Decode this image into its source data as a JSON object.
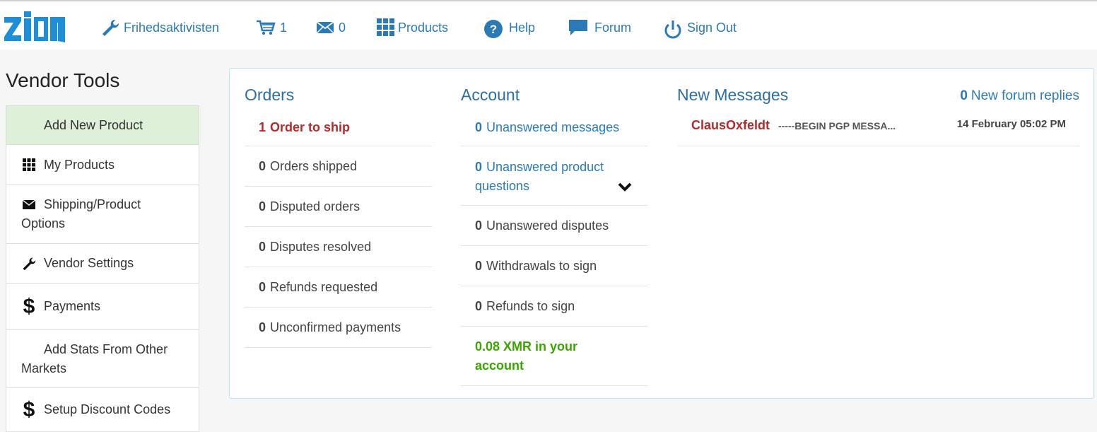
{
  "nav": {
    "logo_text": "zion",
    "username": "Frihedsaktivisten",
    "cart_count": "1",
    "messages_count": "0",
    "products": "Products",
    "help": "Help",
    "forum": "Forum",
    "sign_out": "Sign Out"
  },
  "sidebar": {
    "title": "Vendor Tools",
    "items": [
      {
        "label": "Add New Product"
      },
      {
        "label": "My Products"
      },
      {
        "label_line1": "Shipping/Product",
        "label_line2": "Options"
      },
      {
        "label": "Vendor Settings"
      },
      {
        "label": "Payments"
      },
      {
        "label_line1": "Add Stats From Other",
        "label_line2": "Markets"
      },
      {
        "label": "Setup Discount Codes"
      }
    ]
  },
  "orders": {
    "title": "Orders",
    "rows": [
      {
        "count": "1",
        "label": "Order to ship"
      },
      {
        "count": "0",
        "label": "Orders shipped"
      },
      {
        "count": "0",
        "label": "Disputed orders"
      },
      {
        "count": "0",
        "label": "Disputes resolved"
      },
      {
        "count": "0",
        "label": "Refunds requested"
      },
      {
        "count": "0",
        "label": "Unconfirmed payments"
      }
    ]
  },
  "account": {
    "title": "Account",
    "rows": [
      {
        "count": "0",
        "label": "Unanswered messages"
      },
      {
        "count": "0",
        "label_line1": "Unanswered product",
        "label_line2": "questions"
      },
      {
        "count": "0",
        "label": "Unanswered disputes"
      },
      {
        "count": "0",
        "label": "Withdrawals to sign"
      },
      {
        "count": "0",
        "label": "Refunds to sign"
      }
    ],
    "balance_line1": "0.08 XMR in your",
    "balance_line2": "account"
  },
  "messages": {
    "title": "New Messages",
    "forum_count": "0",
    "forum_label": "New forum replies",
    "items": [
      {
        "sender": "ClausOxfeldt",
        "preview": "-----BEGIN PGP MESSA...",
        "date": "14 February 05:02 PM"
      }
    ]
  },
  "colors": {
    "link": "#2a7ab7",
    "alert": "#b22b2b",
    "balance": "#3aa700",
    "active_bg": "#dff0d8",
    "logo": "#1e8fd6"
  }
}
